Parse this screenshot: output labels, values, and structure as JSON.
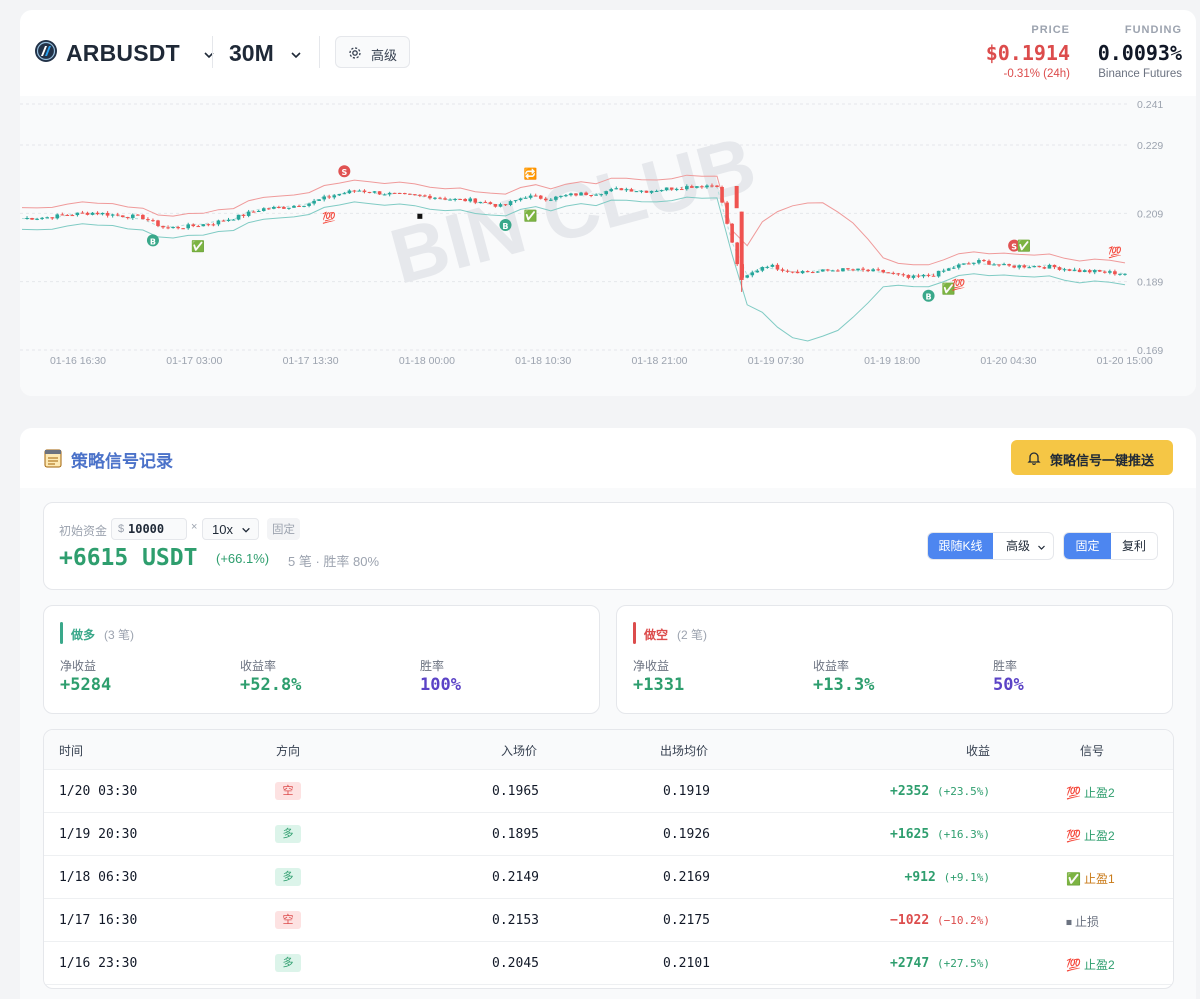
{
  "header": {
    "symbol": "ARBUSDT",
    "timeframe": "30M",
    "advanced_label": "高级",
    "price_label": "PRICE",
    "price_value": "$0.1914",
    "price_change": "-0.31% (24h)",
    "funding_label": "FUNDING",
    "funding_value": "0.0093%",
    "funding_source": "Binance Futures"
  },
  "chart_data": {
    "type": "candlestick",
    "watermark": "BIN CLUB",
    "y_ticks": [
      "0.241",
      "0.229",
      "0.209",
      "0.189",
      "0.169"
    ],
    "ylim": [
      0.169,
      0.241
    ],
    "x_ticks": [
      "01-16 16:30",
      "01-17 03:00",
      "01-17 13:30",
      "01-18 00:00",
      "01-18 10:30",
      "01-18 21:00",
      "01-19 07:30",
      "01-19 18:00",
      "01-20 04:30",
      "01-20 15:00"
    ],
    "close_path": [
      0.2075,
      0.2078,
      0.2087,
      0.2092,
      0.2084,
      0.2079,
      0.2046,
      0.2052,
      0.2062,
      0.208,
      0.2103,
      0.2108,
      0.212,
      0.2143,
      0.2158,
      0.2149,
      0.2142,
      0.214,
      0.213,
      0.2127,
      0.211,
      0.214,
      0.2133,
      0.2145,
      0.215,
      0.2162,
      0.2155,
      0.2163,
      0.217,
      0.2173,
      0.1895,
      0.194,
      0.1922,
      0.1918,
      0.1925,
      0.1923,
      0.1918,
      0.19,
      0.191,
      0.1936,
      0.195,
      0.1935,
      0.1936,
      0.1933,
      0.1922,
      0.1918,
      0.1914
    ],
    "signals": [
      "B",
      "✅",
      "S",
      "💯",
      "⏹",
      "B",
      "✅",
      "🔁",
      "B",
      "✅",
      "💯",
      "S",
      "✅",
      "💯"
    ]
  },
  "strategy": {
    "title": "策略信号记录",
    "push_label": "策略信号一键推送",
    "capital_label": "初始资金",
    "currency": "$",
    "capital_value": "10000",
    "times": "×",
    "leverage": "10x",
    "fixed_tag": "固定",
    "total_pnl": "+6615 USDT",
    "total_pct": "(+66.1%)",
    "meta": "5 笔 · 胜率 80%",
    "mode_buttons": [
      "跟随K线",
      "高级"
    ],
    "compound_buttons": [
      "固定",
      "复利"
    ]
  },
  "long_side": {
    "title": "做多",
    "count": "(3 笔)",
    "net_label": "净收益",
    "net_value": "+5284",
    "ret_label": "收益率",
    "ret_value": "+52.8%",
    "win_label": "胜率",
    "win_value": "100%",
    "color": "#3aa88a"
  },
  "short_side": {
    "title": "做空",
    "count": "(2 笔)",
    "net_label": "净收益",
    "net_value": "+1331",
    "ret_label": "收益率",
    "ret_value": "+13.3%",
    "win_label": "胜率",
    "win_value": "50%",
    "color": "#dc4c4c"
  },
  "table": {
    "headers": [
      "时间",
      "方向",
      "入场价",
      "出场均价",
      "收益",
      "信号"
    ],
    "rows": [
      {
        "time": "1/20 03:30",
        "dir": "空",
        "entry": "0.1965",
        "exit": "0.1919",
        "pnl": "+2352",
        "pct": "(+23.5%)",
        "sig_icon": "💯",
        "sig": "止盈2"
      },
      {
        "time": "1/19 20:30",
        "dir": "多",
        "entry": "0.1895",
        "exit": "0.1926",
        "pnl": "+1625",
        "pct": "(+16.3%)",
        "sig_icon": "💯",
        "sig": "止盈2"
      },
      {
        "time": "1/18 06:30",
        "dir": "多",
        "entry": "0.2149",
        "exit": "0.2169",
        "pnl": "+912",
        "pct": "(+9.1%)",
        "sig_icon": "✅",
        "sig": "止盈1"
      },
      {
        "time": "1/17 16:30",
        "dir": "空",
        "entry": "0.2153",
        "exit": "0.2175",
        "pnl": "−1022",
        "pct": "(−10.2%)",
        "sig_icon": "⏹",
        "sig": "止损"
      },
      {
        "time": "1/16 23:30",
        "dir": "多",
        "entry": "0.2045",
        "exit": "0.2101",
        "pnl": "+2747",
        "pct": "(+27.5%)",
        "sig_icon": "💯",
        "sig": "止盈2"
      }
    ]
  }
}
